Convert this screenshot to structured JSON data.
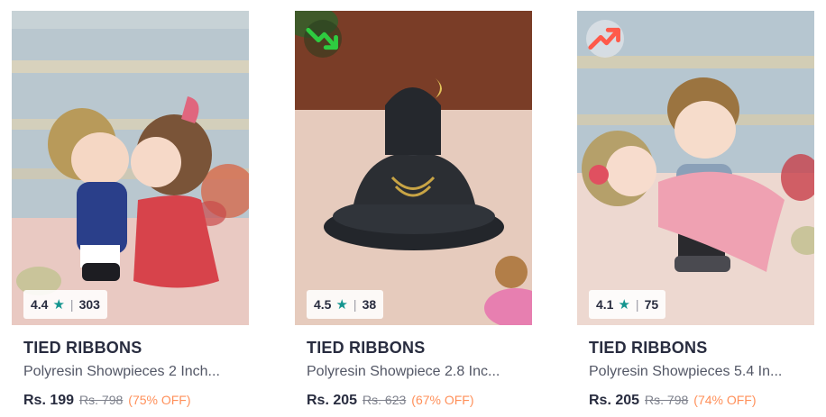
{
  "products": [
    {
      "brand": "TIED RIBBONS",
      "description": "Polyresin Showpieces 2 Inch...",
      "price": "Rs. 199",
      "mrp": "Rs. 798",
      "discount": "(75% OFF)",
      "rating": "4.4",
      "rating_count": "303",
      "trend": "none"
    },
    {
      "brand": "TIED RIBBONS",
      "description": "Polyresin Showpiece 2.8 Inc...",
      "price": "Rs. 205",
      "mrp": "Rs. 623",
      "discount": "(67% OFF)",
      "rating": "4.5",
      "rating_count": "38",
      "trend": "down"
    },
    {
      "brand": "TIED RIBBONS",
      "description": "Polyresin Showpieces 5.4 In...",
      "price": "Rs. 205",
      "mrp": "Rs. 798",
      "discount": "(74% OFF)",
      "rating": "4.1",
      "rating_count": "75",
      "trend": "up"
    }
  ],
  "icons": {
    "rating": "star-icon",
    "trend_down": "trending-down-icon",
    "trend_up": "trending-up-icon"
  },
  "colors": {
    "star": "#14958f",
    "discount": "#ff905a",
    "trend_down": "#2ecc40",
    "trend_up": "#ff5a4a"
  }
}
